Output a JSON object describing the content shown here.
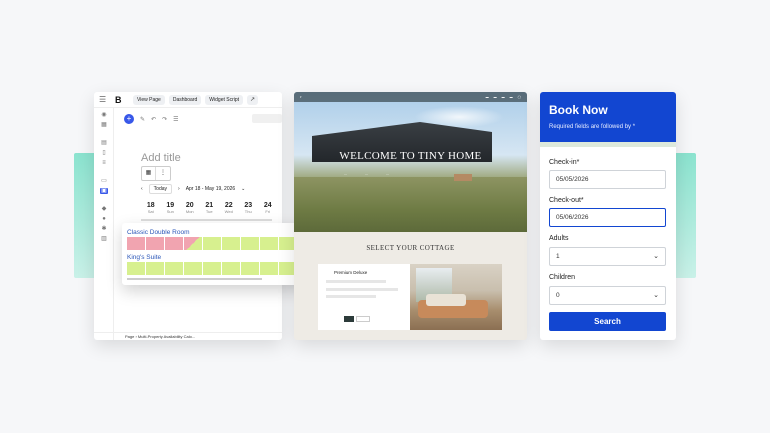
{
  "editor": {
    "toolbar": {
      "logo": "B",
      "view_page": "View Page",
      "dashboard": "Dashboard",
      "widget_script": "Widget Script"
    },
    "add_title": "Add title",
    "calendar": {
      "today": "Today",
      "range": "Apr 18 - May 19, 2026",
      "days": [
        {
          "num": "18",
          "dow": "Sat"
        },
        {
          "num": "19",
          "dow": "Sun"
        },
        {
          "num": "20",
          "dow": "Mon"
        },
        {
          "num": "21",
          "dow": "Tue"
        },
        {
          "num": "22",
          "dow": "Wed"
        },
        {
          "num": "23",
          "dow": "Thu"
        },
        {
          "num": "24",
          "dow": "Fri"
        }
      ]
    },
    "footer": "Page  ›  Multi-Property Availability Calo..."
  },
  "availability": {
    "rooms": [
      {
        "name": "Classic Double Room",
        "cells": [
          "booked",
          "booked",
          "booked",
          "half",
          "free",
          "free",
          "free",
          "free",
          "free",
          "free",
          "free"
        ]
      },
      {
        "name": "King's Suite",
        "cells": [
          "free",
          "free",
          "free",
          "free",
          "free",
          "free",
          "free",
          "free",
          "free",
          "free",
          "free"
        ]
      }
    ],
    "colors": {
      "booked": "#f1a4b0",
      "free": "#d7f08f"
    }
  },
  "site": {
    "hero_title": "WELCOME TO TINY HOME",
    "section_title": "SELECT YOUR COTTAGE",
    "card_name": "Premium Deluxe"
  },
  "booking": {
    "title": "Book Now",
    "subtitle": "Required fields are followed by *",
    "checkin_label": "Check-in*",
    "checkin_value": "05/05/2026",
    "checkout_label": "Check-out*",
    "checkout_value": "05/06/2026",
    "adults_label": "Adults",
    "adults_value": "1",
    "children_label": "Children",
    "children_value": "0",
    "search_label": "Search",
    "accent": "#1246d1"
  }
}
